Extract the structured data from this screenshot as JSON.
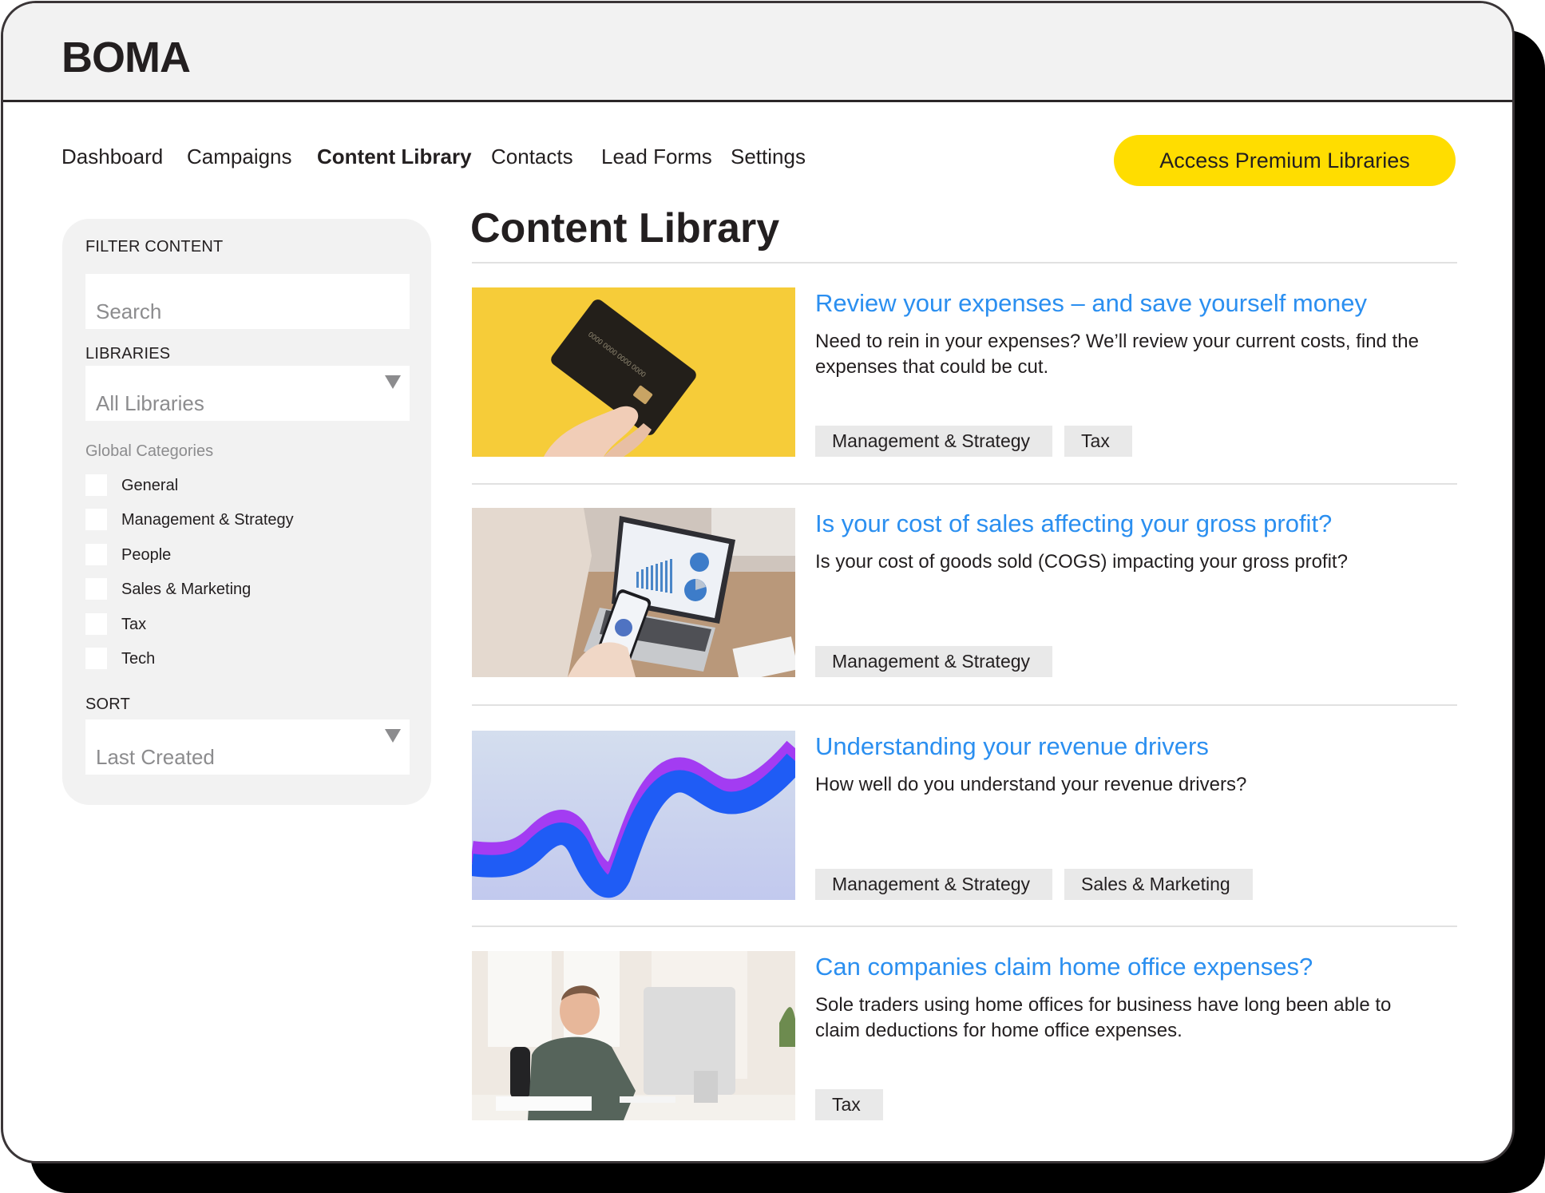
{
  "app": {
    "logo": "BOMA"
  },
  "nav": {
    "items": [
      {
        "label": "Dashboard",
        "active": false
      },
      {
        "label": "Campaigns",
        "active": false
      },
      {
        "label": "Content Library",
        "active": true
      },
      {
        "label": "Contacts",
        "active": false
      },
      {
        "label": "Lead Forms",
        "active": false
      },
      {
        "label": "Settings",
        "active": false
      }
    ],
    "premium_button": "Access Premium Libraries"
  },
  "filters": {
    "heading": "FILTER CONTENT",
    "search_placeholder": "Search",
    "libraries_label": "LIBRARIES",
    "libraries_value": "All Libraries",
    "categories_heading": "Global Categories",
    "categories": [
      {
        "label": "General",
        "checked": false
      },
      {
        "label": "Management & Strategy",
        "checked": false
      },
      {
        "label": "People",
        "checked": false
      },
      {
        "label": "Sales & Marketing",
        "checked": false
      },
      {
        "label": "Tax",
        "checked": false
      },
      {
        "label": "Tech",
        "checked": false
      }
    ],
    "sort_label": "SORT",
    "sort_value": "Last Created"
  },
  "main": {
    "title": "Content Library",
    "articles": [
      {
        "title": "Review your expenses – and save yourself money",
        "description": "Need to rein in your expenses? We’ll review your current costs, find the expenses that could be cut.",
        "tags": [
          "Management & Strategy",
          "Tax"
        ],
        "image": "credit-card-image"
      },
      {
        "title": "Is your cost of sales affecting your gross profit?",
        "description": "Is your cost of goods sold (COGS) impacting your gross profit?",
        "tags": [
          "Management & Strategy"
        ],
        "image": "laptop-charts-image"
      },
      {
        "title": "Understanding your revenue drivers",
        "description": "How well do you understand your revenue drivers?",
        "tags": [
          "Management & Strategy",
          "Sales & Marketing"
        ],
        "image": "growth-wave-image"
      },
      {
        "title": "Can companies claim home office expenses?",
        "description": "Sole traders using home offices for business have long been able to claim deductions for home office expenses.",
        "tags": [
          "Tax"
        ],
        "image": "home-office-image"
      }
    ]
  },
  "colors": {
    "accent_yellow": "#ffdd00",
    "link_blue": "#2b8ff0",
    "panel_gray": "#f2f2f2",
    "tag_gray": "#e9e9e9"
  }
}
